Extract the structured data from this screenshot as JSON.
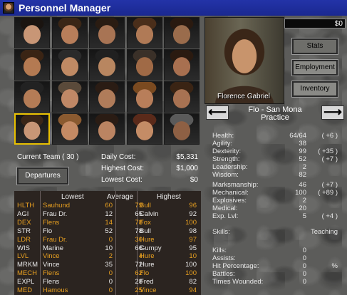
{
  "window": {
    "title": "Personnel Manager",
    "icon": "personnel-app-icon"
  },
  "portraits": [
    {
      "skin": "#c89676",
      "hair": "#1a1410"
    },
    {
      "skin": "#b87e5a",
      "hair": "#3a2616"
    },
    {
      "skin": "#a87454",
      "hair": "#2a1c12"
    },
    {
      "skin": "#b07a56",
      "hair": "#4a2e1a"
    },
    {
      "skin": "#9a6c4c",
      "hair": "#2a1a10"
    },
    {
      "skin": "#b47a52",
      "hair": "#3a2414"
    },
    {
      "skin": "#c08a64",
      "hair": "#2a2a2a"
    },
    {
      "skin": "#b88660",
      "hair": "#202020"
    },
    {
      "skin": "#a06a46",
      "hair": "#3a3028"
    },
    {
      "skin": "#a87050",
      "hair": "#2a1a10"
    },
    {
      "skin": "#b47c56",
      "hair": "#222"
    },
    {
      "skin": "#c08866",
      "hair": "#5a4a3a"
    },
    {
      "skin": "#b07c5a",
      "hair": "#2a1c14"
    },
    {
      "skin": "#b87e5a",
      "hair": "#7a4a20"
    },
    {
      "skin": "#a87252",
      "hair": "#3a2414"
    },
    {
      "skin": "#c89676",
      "hair": "#3a2618"
    },
    {
      "skin": "#c48a64",
      "hair": "#8a5a30"
    },
    {
      "skin": "#bb8462",
      "hair": "#2a1c14"
    },
    {
      "skin": "#c48c66",
      "hair": "#5a2a1a"
    },
    {
      "skin": "#8e6044",
      "hair": "#5a5a5a"
    }
  ],
  "selected_portrait": 15,
  "money": "$0",
  "selected_merc": {
    "portrait_name": "Florence Gabriel",
    "name": "Flo - San Mona",
    "location": "Practice"
  },
  "side_buttons": {
    "stats": "Stats",
    "employment": "Employment",
    "inventory": "Inventory"
  },
  "nav": {
    "prev": "⟵",
    "next": "⟶"
  },
  "stats": [
    {
      "label": "Health:",
      "value": "64/64",
      "bonus": "( +6 )"
    },
    {
      "label": "Agility:",
      "value": "38",
      "bonus": ""
    },
    {
      "label": "Dexterity:",
      "value": "99",
      "bonus": "( +35 )"
    },
    {
      "label": "Strength:",
      "value": "52",
      "bonus": "( +7 )"
    },
    {
      "label": "Leadership:",
      "value": "2",
      "bonus": ""
    },
    {
      "label": "Wisdom:",
      "value": "82",
      "bonus": ""
    },
    {
      "label": "Marksmanship:",
      "value": "46",
      "bonus": "( +7 )"
    },
    {
      "label": "Mechanical:",
      "value": "100",
      "bonus": "( +89 )"
    },
    {
      "label": "Explosives:",
      "value": "2",
      "bonus": ""
    },
    {
      "label": "Medical:",
      "value": "20",
      "bonus": ""
    },
    {
      "label": "Exp. Lvl:",
      "value": "5",
      "bonus": "( +4 )"
    },
    {
      "label": "Skills:",
      "value": "",
      "bonus": "Teaching"
    },
    {
      "label": "Kills:",
      "value": "0",
      "bonus": ""
    },
    {
      "label": "Assists:",
      "value": "0",
      "bonus": ""
    },
    {
      "label": "Hit Percentage:",
      "value": "0",
      "bonus": "%"
    },
    {
      "label": "Battles:",
      "value": "0",
      "bonus": ""
    },
    {
      "label": "Times Wounded:",
      "value": "0",
      "bonus": ""
    }
  ],
  "team": {
    "current_team": "Current Team ( 30 )",
    "daily_cost_label": "Daily Cost:",
    "daily_cost": "$5,331",
    "highest_cost_label": "Highest Cost:",
    "highest_cost": "$1,000",
    "lowest_cost_label": "Lowest Cost:",
    "lowest_cost": "$0",
    "departures": "Departures"
  },
  "table": {
    "headers": {
      "lowest": "Lowest",
      "average": "Average",
      "highest": "Highest"
    },
    "colors": {
      "orange": "#e8a020",
      "white": "#e8e8e8"
    },
    "rows": [
      {
        "stat": "HLTH",
        "lname": "Sauhund",
        "lval": "60",
        "avg": "79",
        "hname": "Bull",
        "hval": "96",
        "color": "orange"
      },
      {
        "stat": "AGI",
        "lname": "Frau Dr.",
        "lval": "12",
        "avg": "65",
        "hname": "Calvin",
        "hval": "92",
        "color": "white"
      },
      {
        "stat": "DEX",
        "lname": "Flens",
        "lval": "14",
        "avg": "78",
        "hname": "Fox",
        "hval": "100",
        "color": "orange"
      },
      {
        "stat": "STR",
        "lname": "Flo",
        "lval": "52",
        "avg": "78",
        "hname": "Bull",
        "hval": "98",
        "color": "white"
      },
      {
        "stat": "LDR",
        "lname": "Frau Dr.",
        "lval": "0",
        "avg": "30",
        "hname": "Hure",
        "hval": "97",
        "color": "orange"
      },
      {
        "stat": "WIS",
        "lname": "Marine",
        "lval": "10",
        "avg": "66",
        "hname": "Gumpy",
        "hval": "95",
        "color": "white"
      },
      {
        "stat": "LVL",
        "lname": "Vince",
        "lval": "2",
        "avg": "4",
        "hname": "Hure",
        "hval": "10",
        "color": "orange"
      },
      {
        "stat": "MRKM",
        "lname": "Vince",
        "lval": "35",
        "avg": "72",
        "hname": "Hure",
        "hval": "100",
        "color": "white"
      },
      {
        "stat": "MECH",
        "lname": "Flens",
        "lval": "0",
        "avg": "62",
        "hname": "Flo",
        "hval": "100",
        "color": "orange"
      },
      {
        "stat": "EXPL",
        "lname": "Flens",
        "lval": "0",
        "avg": "28",
        "hname": "Fred",
        "hval": "82",
        "color": "white"
      },
      {
        "stat": "MED",
        "lname": "Hamous",
        "lval": "0",
        "avg": "25",
        "hname": "Vince",
        "hval": "94",
        "color": "orange"
      }
    ]
  }
}
